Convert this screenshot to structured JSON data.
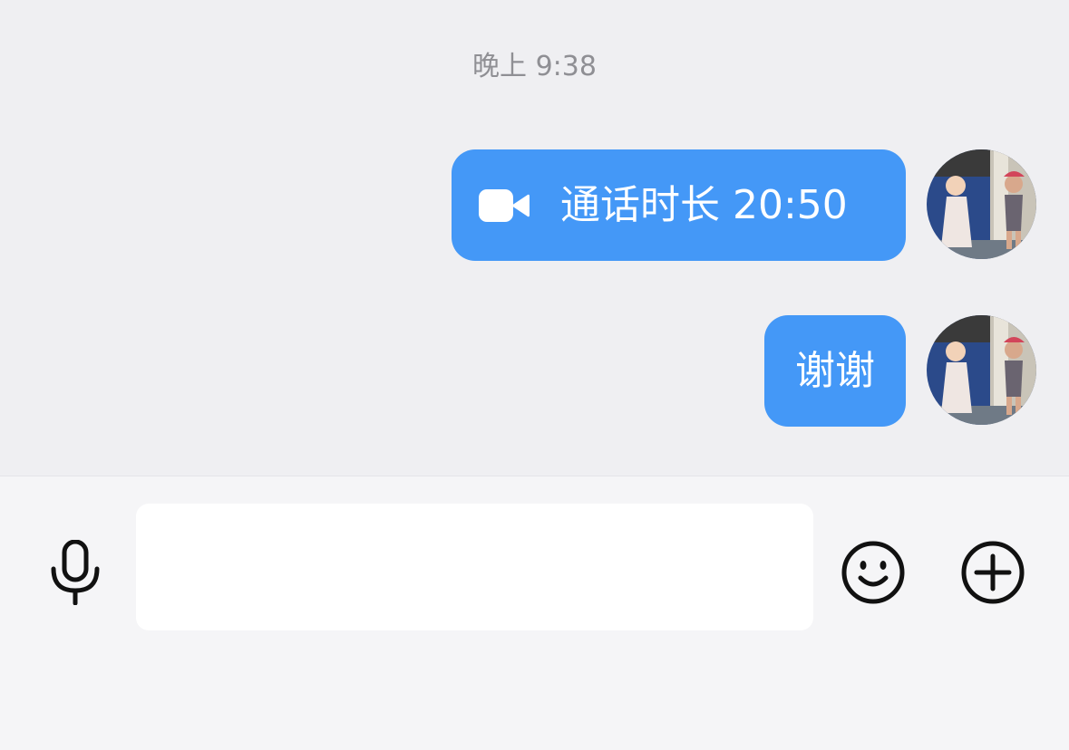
{
  "chat": {
    "timestamp": "晚上 9:38",
    "messages": [
      {
        "type": "video-call",
        "icon": "video-camera-icon",
        "text": "通话时长 20:50"
      },
      {
        "type": "text",
        "text": "谢谢"
      }
    ]
  },
  "input_bar": {
    "voice_icon": "microphone-icon",
    "text_value": "",
    "emoji_icon": "smiley-face-icon",
    "more_icon": "plus-circle-icon"
  },
  "colors": {
    "bubble": "#4498f7",
    "chat_background": "#efeff2",
    "input_background": "#f5f5f7",
    "timestamp_text": "#8f8f94"
  }
}
